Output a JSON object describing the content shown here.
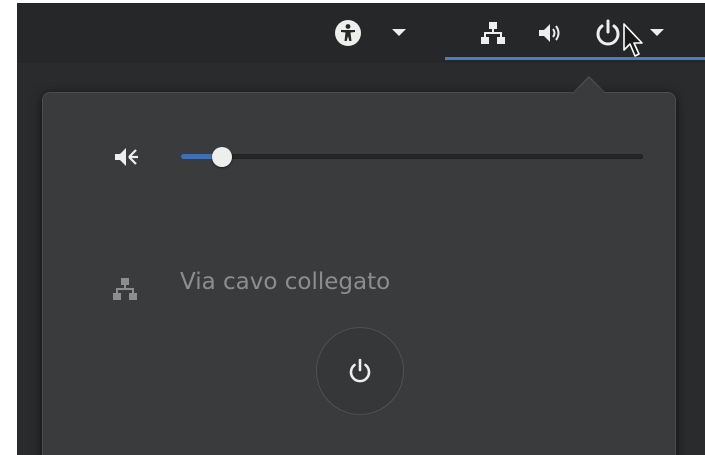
{
  "topbar": {
    "accessibility_icon": "accessibility-icon",
    "accessibility_dropdown_icon": "chevron-down-icon",
    "network_icon": "wired-network-icon",
    "volume_icon": "volume-high-icon",
    "power_icon": "power-icon",
    "system_menu_dropdown_icon": "chevron-down-icon",
    "accent_color": "#4a7ec4"
  },
  "system_menu": {
    "volume": {
      "icon": "volume-low-icon",
      "level": 0.07,
      "accent_color": "#3f6fb7"
    },
    "network": {
      "icon": "wired-network-icon",
      "status": "Via cavo collegato"
    },
    "power_button": {
      "icon": "power-icon"
    }
  }
}
